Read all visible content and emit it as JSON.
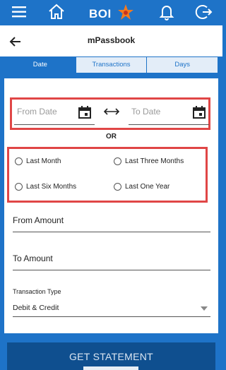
{
  "header": {
    "logo_text": "BOI",
    "brand_color": "#1e73c8",
    "icons": [
      "menu-icon",
      "home-icon",
      "bell-icon",
      "logout-icon"
    ]
  },
  "titlebar": {
    "title": "mPassbook",
    "back_icon": "back-arrow-icon"
  },
  "tabs": [
    {
      "label": "Date",
      "active": true
    },
    {
      "label": "Transactions",
      "active": false
    },
    {
      "label": "Days",
      "active": false
    }
  ],
  "date_range": {
    "from_placeholder": "From Date",
    "to_placeholder": "To Date",
    "or_label": "OR"
  },
  "quick_ranges": [
    {
      "label": "Last Month",
      "selected": false
    },
    {
      "label": "Last Three Months",
      "selected": false
    },
    {
      "label": "Last Six Months",
      "selected": false
    },
    {
      "label": "Last One Year",
      "selected": false
    }
  ],
  "amounts": {
    "from_label": "From Amount",
    "to_label": "To Amount"
  },
  "transaction_type": {
    "label": "Transaction Type",
    "value": "Debit & Credit"
  },
  "submit_label": "GET STATEMENT",
  "highlight_color": "#e04646"
}
